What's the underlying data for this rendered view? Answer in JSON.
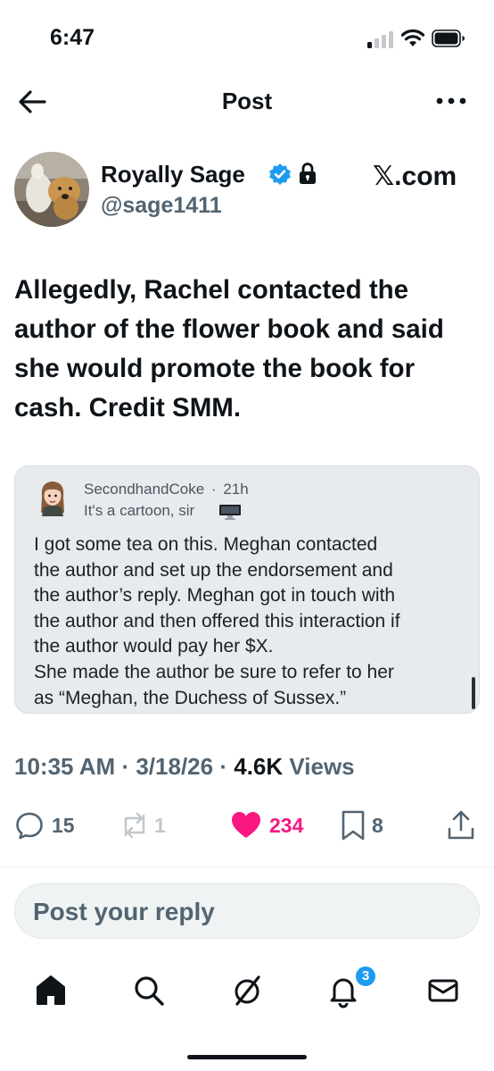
{
  "status_bar": {
    "time": "6:47"
  },
  "header": {
    "title": "Post"
  },
  "author": {
    "name": "Royally Sage",
    "handle": "@sage1411",
    "verified": true,
    "protected": true
  },
  "watermark": "𝕏.com",
  "post": {
    "text": "Allegedly, Rachel contacted the author of the flower book and said she would promote the book for cash. Credit SMM."
  },
  "embed": {
    "username": "SecondhandCoke",
    "separator": "·",
    "age": "21h",
    "subtitle": "It's a cartoon, sir",
    "lines": [
      "I got some tea on this. Meghan contacted",
      "the author and set up the endorsement and",
      "the author’s reply.  Meghan got in touch with",
      "the author and then offered this interaction if",
      "the author would pay her $X.",
      "She made the author be sure to refer to her",
      "as “Meghan, the Duchess of Sussex.”"
    ]
  },
  "meta": {
    "time": "10:35 AM",
    "date": "3/18/26",
    "views_count": "4.6K",
    "views_label": "Views",
    "separator": "·"
  },
  "actions": {
    "replies": "15",
    "reposts": "1",
    "likes": "234",
    "bookmarks": "8",
    "like_color": "#f91880"
  },
  "reply": {
    "placeholder": "Post your reply"
  },
  "nav": {
    "items": [
      "home-icon",
      "search-icon",
      "grok-icon",
      "notifications-icon",
      "messages-icon"
    ],
    "notification_count": "3",
    "accent": "#1d9bf0"
  }
}
